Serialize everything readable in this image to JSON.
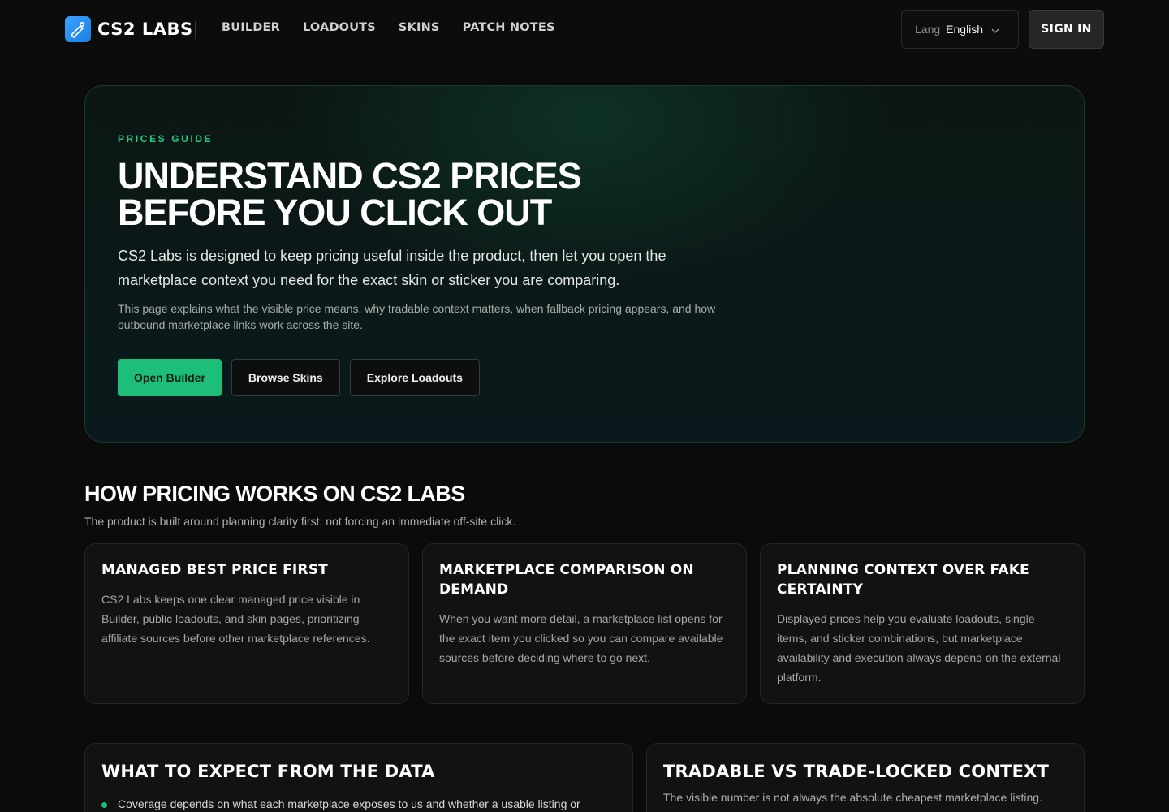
{
  "brand": {
    "name": "CS2 LABS"
  },
  "nav": {
    "items": [
      "BUILDER",
      "LOADOUTS",
      "SKINS",
      "PATCH NOTES"
    ]
  },
  "language": {
    "label": "Lang",
    "value": "English"
  },
  "auth": {
    "signin_label": "SIGN IN"
  },
  "hero": {
    "eyebrow": "PRICES GUIDE",
    "title_line1": "UNDERSTAND CS2 PRICES",
    "title_line2": "BEFORE YOU CLICK OUT",
    "lead": "CS2 Labs is designed to keep pricing useful inside the product, then let you open the marketplace context you need for the exact skin or sticker you are comparing.",
    "sub": "This page explains what the visible price means, why tradable context matters, when fallback pricing appears, and how outbound marketplace links work across the site.",
    "buttons": [
      "Open Builder",
      "Browse Skins",
      "Explore Loadouts"
    ]
  },
  "how": {
    "title": "HOW PRICING WORKS ON CS2 LABS",
    "subtitle": "The product is built around planning clarity first, not forcing an immediate off-site click.",
    "cards": [
      {
        "title": "MANAGED BEST PRICE FIRST",
        "body": "CS2 Labs keeps one clear managed price visible in Builder, public loadouts, and skin pages, prioritizing affiliate sources before other marketplace references."
      },
      {
        "title": "MARKETPLACE COMPARISON ON DEMAND",
        "body": "When you want more detail, a marketplace list opens for the exact item you clicked so you can compare available sources before deciding where to go next."
      },
      {
        "title": "PLANNING CONTEXT OVER FAKE CERTAINTY",
        "body": "Displayed prices help you evaluate loadouts, single items, and sticker combinations, but marketplace availability and execution always depend on the external platform."
      }
    ]
  },
  "expect": {
    "title": "WHAT TO EXPECT FROM THE DATA",
    "bullet": "Coverage depends on what each marketplace exposes to us and whether a usable listing or"
  },
  "tradable": {
    "title": "TRADABLE VS TRADE-LOCKED CONTEXT",
    "body": "The visible number is not always the absolute cheapest marketplace listing."
  },
  "colors": {
    "accent": "#1dbf78",
    "eyebrow": "#26c77e",
    "background": "#0b0b0b"
  }
}
